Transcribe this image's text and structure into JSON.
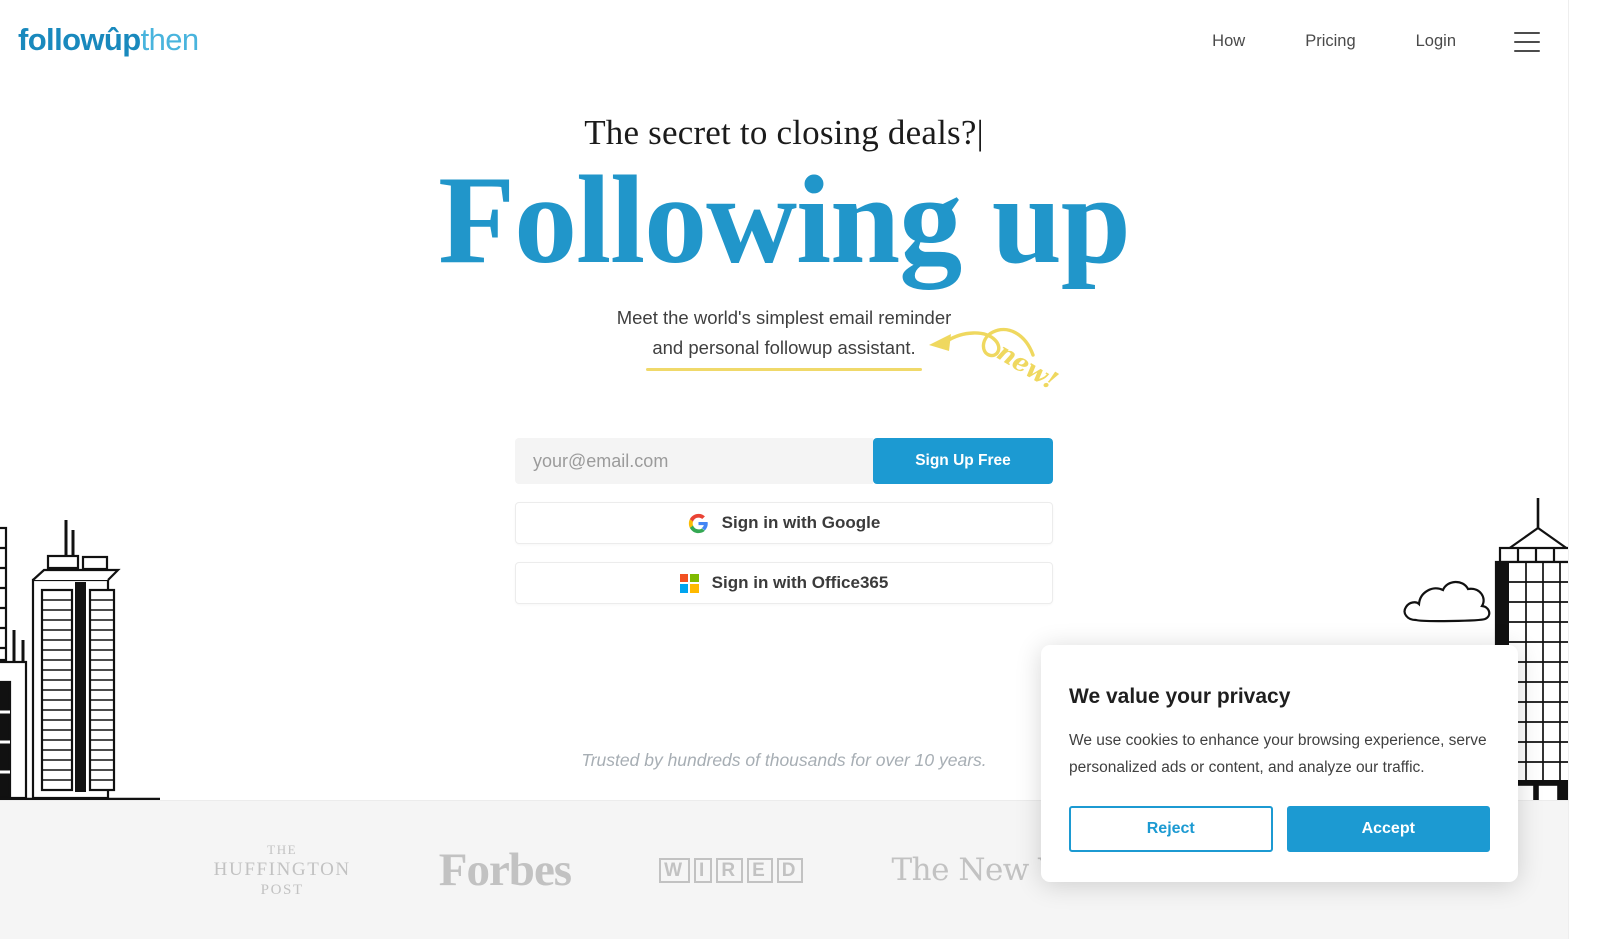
{
  "brand": {
    "logo_bold": "followûp",
    "logo_light": "then",
    "accent_color": "#1c9ad2",
    "logo_bold_color": "#1989bd",
    "logo_light_color": "#49b4dd"
  },
  "nav": {
    "links": [
      {
        "label": "How"
      },
      {
        "label": "Pricing"
      },
      {
        "label": "Login"
      }
    ],
    "menu_icon": "hamburger-icon"
  },
  "hero": {
    "typed_text": "The secret to closing deals?",
    "caret": "|",
    "title": "Following up",
    "subtitle_line1": "Meet the world's simplest email reminder",
    "subtitle_line2": "and personal followup assistant.",
    "annotation": "new!",
    "annotation_color": "#efd85f"
  },
  "signup": {
    "email_placeholder": "your@email.com",
    "email_value": "",
    "submit_label": "Sign Up Free",
    "google_label": "Sign in with Google",
    "office_label": "Sign in with Office365"
  },
  "social_proof": {
    "trusted_text": "Trusted by hundreds of thousands for over 10 years.",
    "press": [
      {
        "name": "huffington-post",
        "line1": "THE",
        "line2": "HUFFINGTON",
        "line3": "POST"
      },
      {
        "name": "forbes",
        "text": "Forbes"
      },
      {
        "name": "wired",
        "letters": [
          "W",
          "I",
          "R",
          "E",
          "D"
        ]
      },
      {
        "name": "new-york-times",
        "text": "The New York Times"
      },
      {
        "name": "the-partial",
        "text": "The"
      }
    ]
  },
  "cookie_banner": {
    "title": "We value your privacy",
    "body": "We use cookies to enhance your browsing experience, serve personalized ads or content, and analyze our traffic.",
    "reject_label": "Reject",
    "accept_label": "Accept"
  }
}
